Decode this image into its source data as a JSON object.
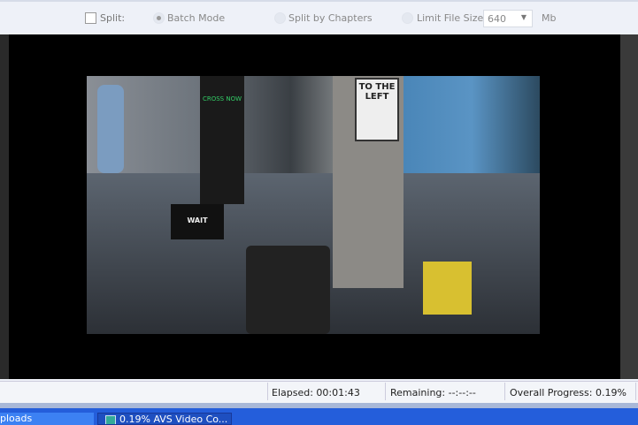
{
  "toolbar": {
    "split_label": "Split:",
    "batch_mode": "Batch Mode",
    "split_by_chapters": "Split by Chapters",
    "limit_file_size": "Limit File Size",
    "size_value": "640",
    "size_unit": "Mb"
  },
  "frame_signs": {
    "to_the_left": "TO THE LEFT",
    "wait": "WAIT",
    "cross_now": "CROSS NOW"
  },
  "status": {
    "elapsed": "Elapsed: 00:01:43",
    "remaining": "Remaining: --:--:--",
    "overall_progress": "Overall Progress: 0.19%"
  },
  "taskbar": {
    "item1": "ploads",
    "item2": "0.19% AVS Video Co..."
  }
}
